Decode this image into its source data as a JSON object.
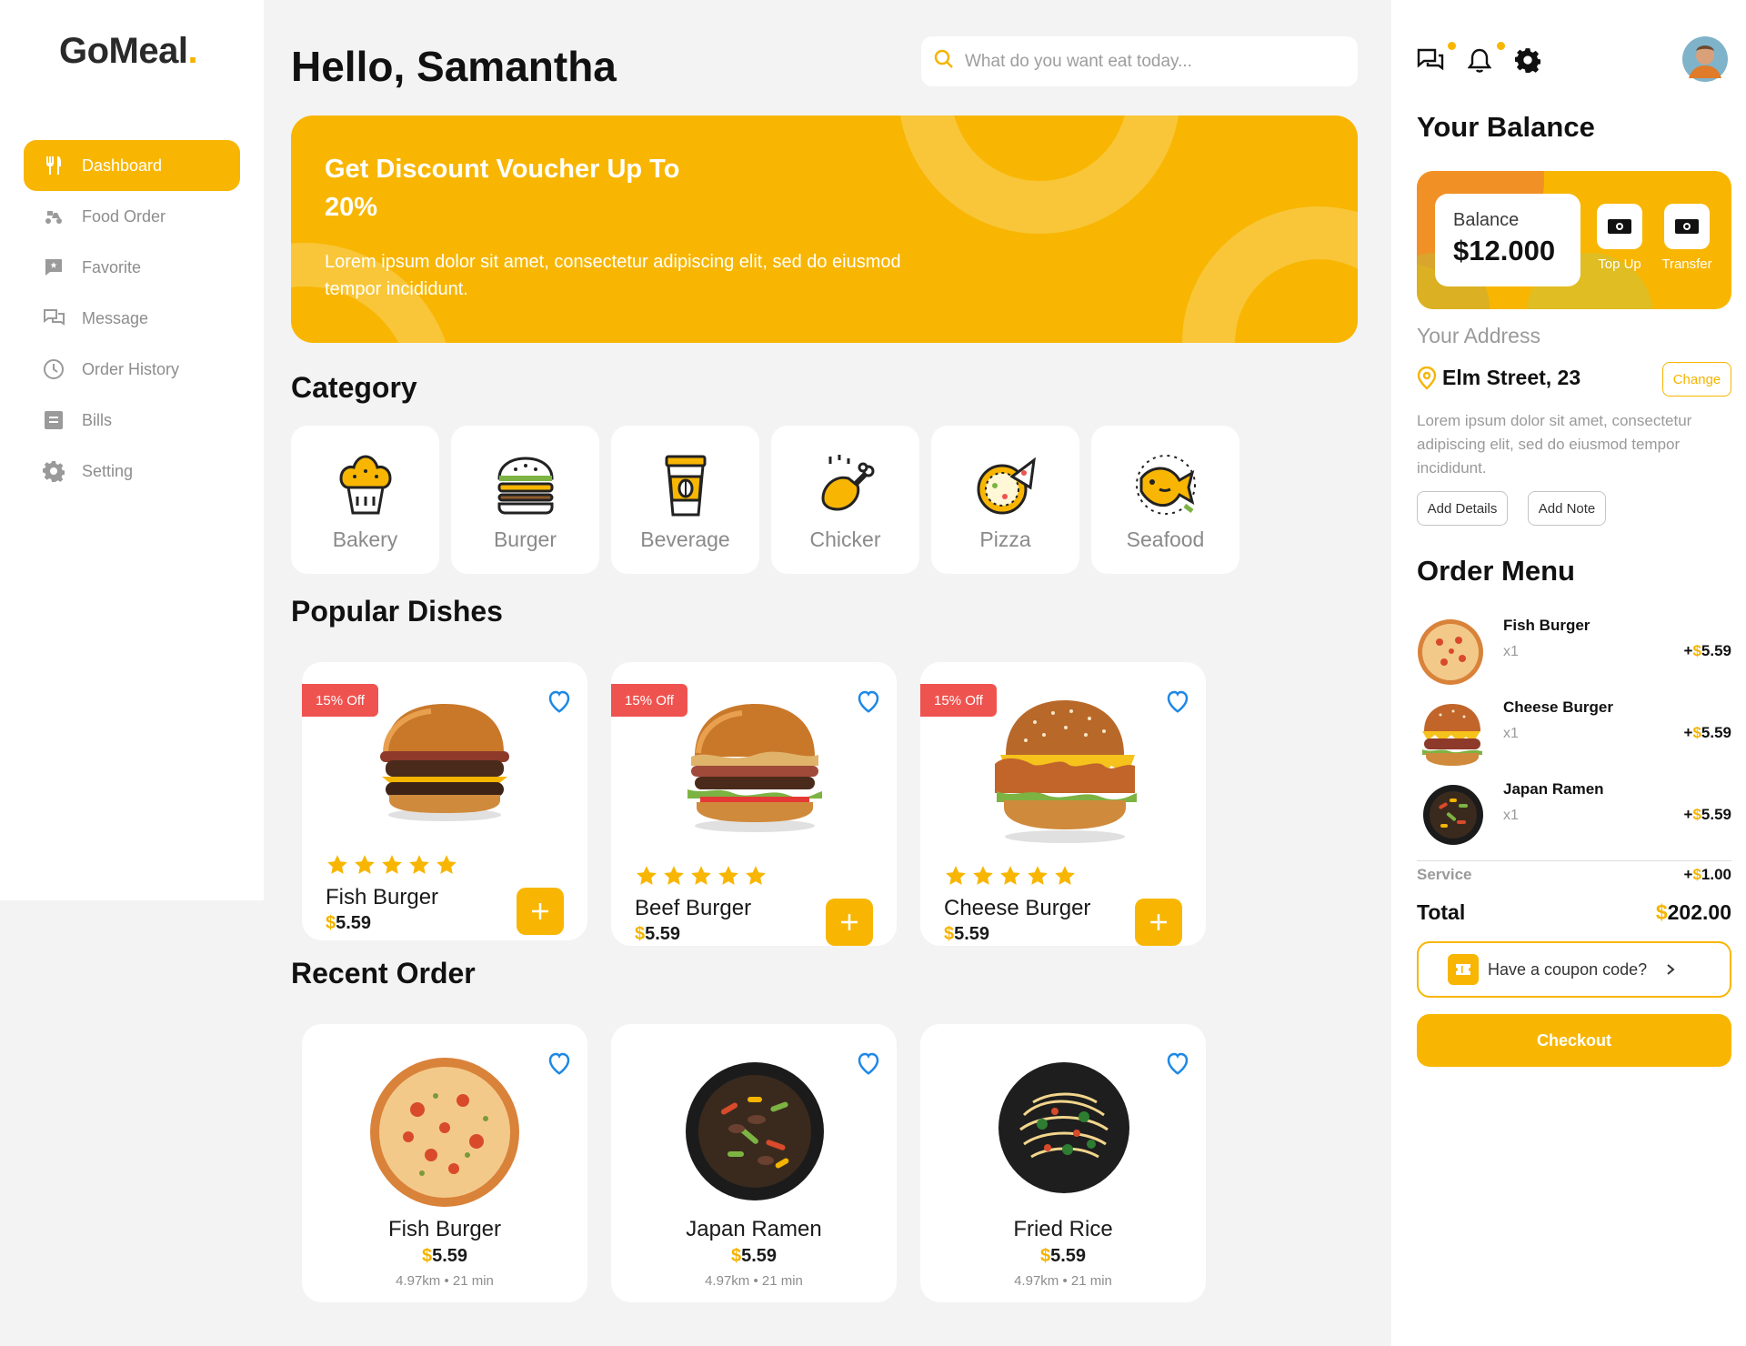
{
  "brand": {
    "logo_text": "GoMeal",
    "logo_dot": ".",
    "accent": "#f8b602"
  },
  "sidebar": {
    "items": [
      {
        "label": "Dashboard",
        "icon": "utensils-icon",
        "active": true
      },
      {
        "label": "Food Order",
        "icon": "scooter-icon"
      },
      {
        "label": "Favorite",
        "icon": "favorite-chat-icon"
      },
      {
        "label": "Message",
        "icon": "message-icon"
      },
      {
        "label": "Order History",
        "icon": "clock-icon"
      },
      {
        "label": "Bills",
        "icon": "bill-icon"
      },
      {
        "label": "Setting",
        "icon": "gear-icon"
      }
    ]
  },
  "header": {
    "greeting": "Hello, Samantha",
    "search_placeholder": "What do you want eat today..."
  },
  "banner": {
    "title": "Get Discount Voucher Up To 20%",
    "description": "Lorem ipsum dolor sit amet, consectetur adipiscing elit, sed do eiusmod tempor incididunt."
  },
  "category": {
    "title": "Category",
    "items": [
      {
        "label": "Bakery",
        "icon": "cupcake-icon"
      },
      {
        "label": "Burger",
        "icon": "burger-icon"
      },
      {
        "label": "Beverage",
        "icon": "coffee-cup-icon"
      },
      {
        "label": "Chicker",
        "icon": "chicken-leg-icon"
      },
      {
        "label": "Pizza",
        "icon": "pizza-icon"
      },
      {
        "label": "Seafood",
        "icon": "fish-icon"
      }
    ]
  },
  "popular": {
    "title": "Popular Dishes",
    "items": [
      {
        "badge": "15% Off",
        "name": "Fish Burger",
        "currency": "$",
        "price": "5.59",
        "rating": 5
      },
      {
        "badge": "15% Off",
        "name": "Beef Burger",
        "currency": "$",
        "price": "5.59",
        "rating": 5
      },
      {
        "badge": "15% Off",
        "name": "Cheese Burger",
        "currency": "$",
        "price": "5.59",
        "rating": 5
      }
    ]
  },
  "recent": {
    "title": "Recent Order",
    "items": [
      {
        "name": "Fish Burger",
        "currency": "$",
        "price": "5.59",
        "meta": "4.97km • 21 min"
      },
      {
        "name": "Japan Ramen",
        "currency": "$",
        "price": "5.59",
        "meta": "4.97km • 21 min"
      },
      {
        "name": "Fried Rice",
        "currency": "$",
        "price": "5.59",
        "meta": "4.97km • 21 min"
      }
    ]
  },
  "balance": {
    "title": "Your Balance",
    "label": "Balance",
    "amount": "$12.000",
    "top_up": "Top Up",
    "transfer": "Transfer"
  },
  "address": {
    "label": "Your Address",
    "street": "Elm Street, 23",
    "change": "Change",
    "description": "Lorem ipsum dolor sit amet, consectetur adipiscing elit, sed do eiusmod tempor incididunt.",
    "add_details": "Add Details",
    "add_note": "Add Note"
  },
  "order_menu": {
    "title": "Order Menu",
    "items": [
      {
        "name": "Fish Burger",
        "qty": "x1",
        "sign": "+",
        "currency": "$",
        "price": "5.59"
      },
      {
        "name": "Cheese Burger",
        "qty": "x1",
        "sign": "+",
        "currency": "$",
        "price": "5.59"
      },
      {
        "name": "Japan Ramen",
        "qty": "x1",
        "sign": "+",
        "currency": "$",
        "price": "5.59"
      }
    ],
    "service_label": "Service",
    "service_sign": "+",
    "service_currency": "$",
    "service_value": "1.00",
    "total_label": "Total",
    "total_currency": "$",
    "total_value": "202.00",
    "coupon": "Have a coupon code?",
    "checkout": "Checkout"
  }
}
